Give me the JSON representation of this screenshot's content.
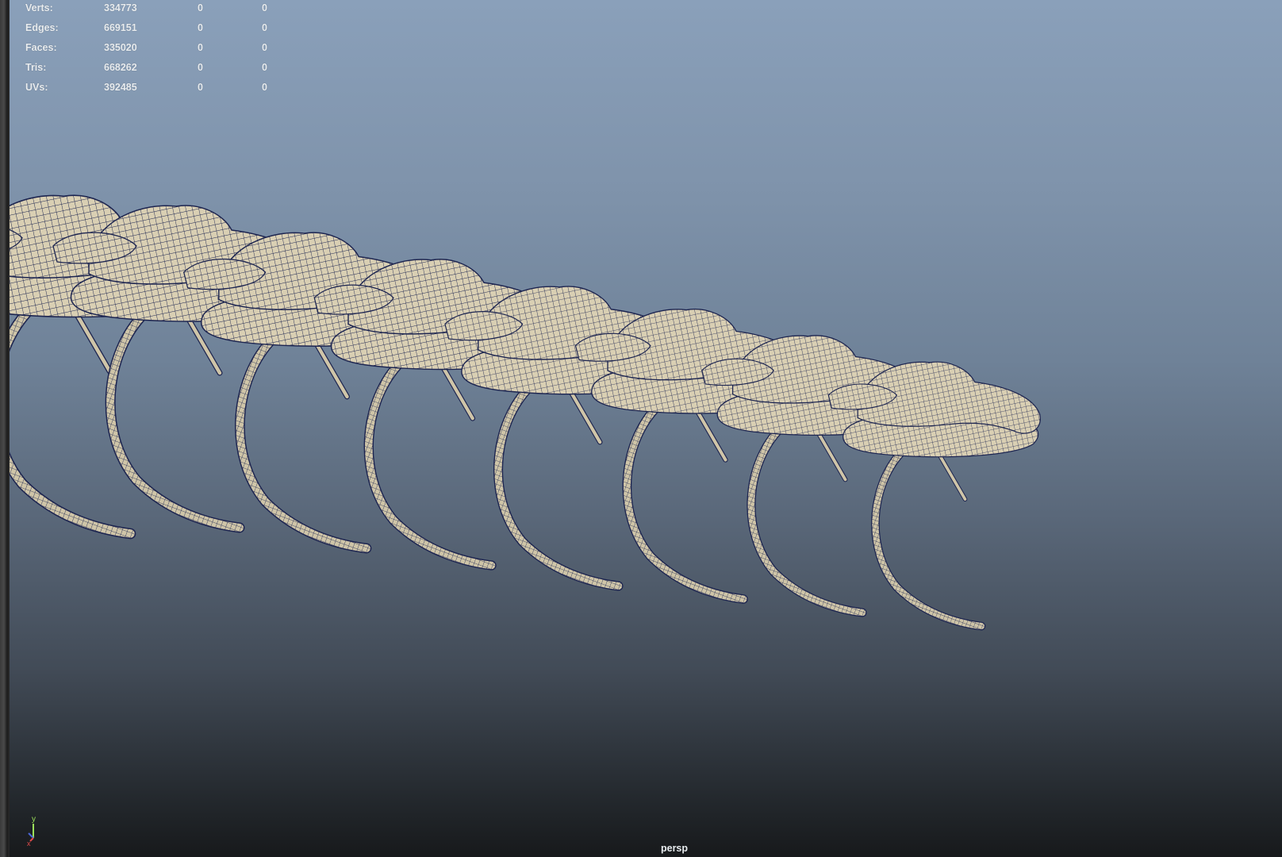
{
  "hud": {
    "rows": [
      {
        "label": "Verts:",
        "value": "334773",
        "selected": "0",
        "highlighted": "0"
      },
      {
        "label": "Edges:",
        "value": "669151",
        "selected": "0",
        "highlighted": "0"
      },
      {
        "label": "Faces:",
        "value": "335020",
        "selected": "0",
        "highlighted": "0"
      },
      {
        "label": "Tris:",
        "value": "668262",
        "selected": "0",
        "highlighted": "0"
      },
      {
        "label": "UVs:",
        "value": "392485",
        "selected": "0",
        "highlighted": "0"
      }
    ]
  },
  "axis": {
    "y": "y",
    "x": "x"
  },
  "viewport": {
    "camera": "persp"
  },
  "colors": {
    "bone": "#d9cfb3",
    "wire": "#1d2550",
    "gradient_top": "#8aa0ba",
    "gradient_bottom": "#17191b"
  },
  "icons": [
    "axis-gizmo-icon"
  ]
}
